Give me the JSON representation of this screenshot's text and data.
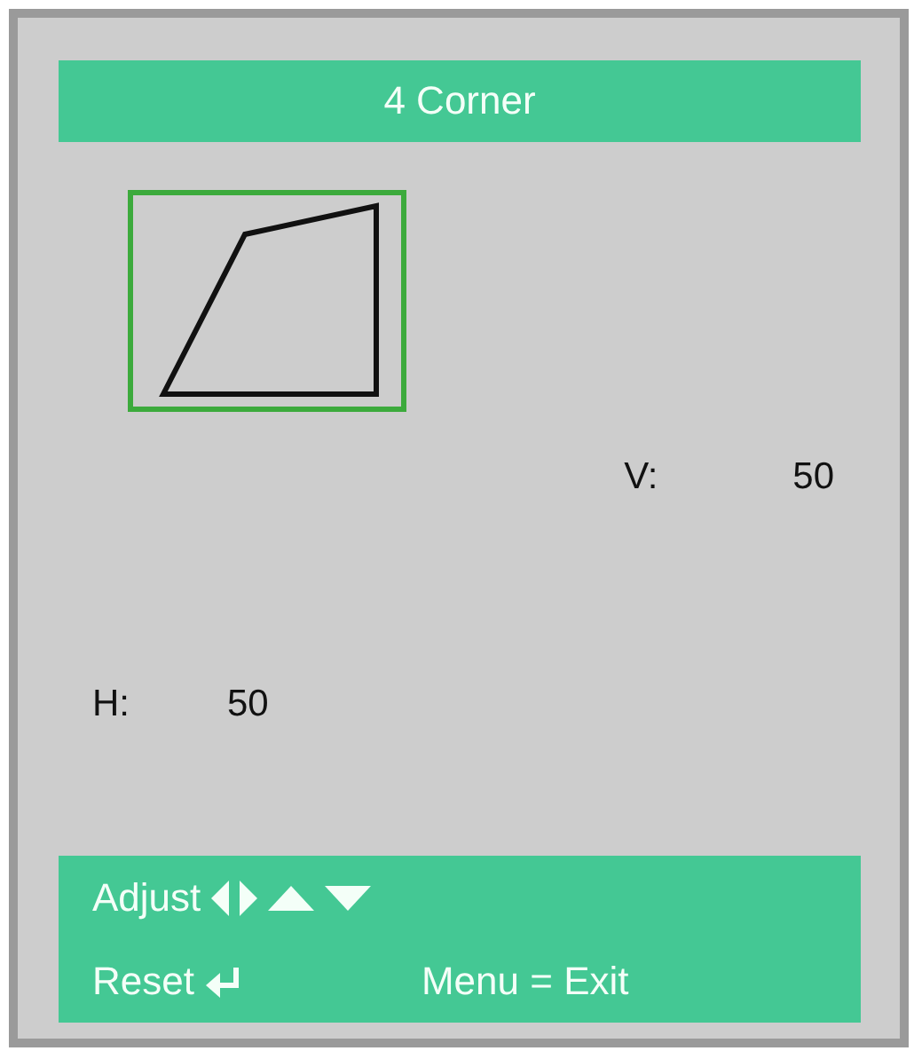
{
  "title": "4 Corner",
  "vertical": {
    "label": "V:",
    "value": "50"
  },
  "horizontal": {
    "label": "H:",
    "value": "50"
  },
  "footer": {
    "adjust": "Adjust",
    "reset": "Reset",
    "exit": "Menu = Exit"
  }
}
